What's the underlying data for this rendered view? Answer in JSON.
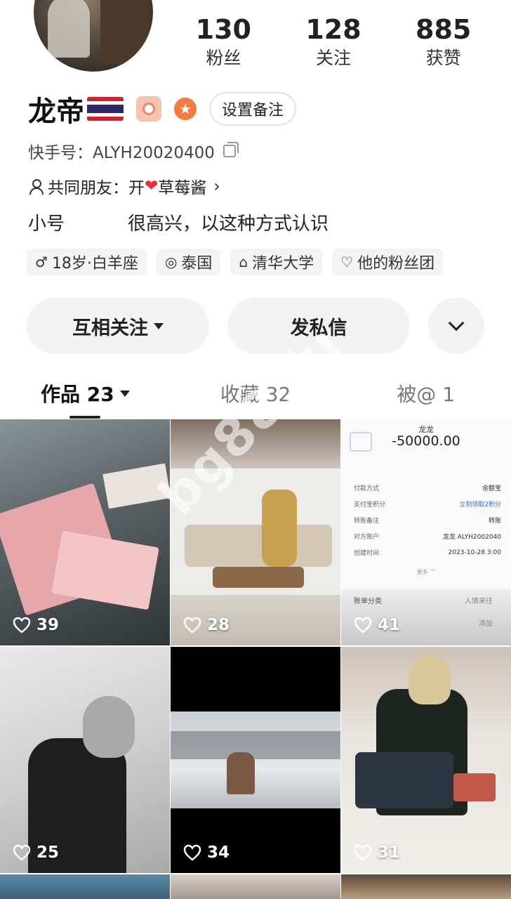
{
  "profile": {
    "name": "龙帝",
    "kuaishou_id": "快手号：ALYH20020400",
    "remark_button": "设置备注",
    "badge_star": "★",
    "mutual_friends_label": "共同朋友：",
    "mutual_friends_pre": "开",
    "mutual_friends_heart": "❤",
    "mutual_friends_post": "草莓酱",
    "mutual_chevron": "›",
    "bio_left": "小号",
    "bio_right": "很高兴，以这种方式认识"
  },
  "stats": [
    {
      "num": "130",
      "label": "粉丝"
    },
    {
      "num": "128",
      "label": "关注"
    },
    {
      "num": "885",
      "label": "获赞"
    }
  ],
  "tags": [
    {
      "icon": "♂",
      "label": "18岁·白羊座"
    },
    {
      "icon": "◎",
      "label": "泰国"
    },
    {
      "icon": "⌂",
      "label": "清华大学"
    },
    {
      "icon": "♡",
      "label": "他的粉丝团"
    }
  ],
  "actions": {
    "follow": "互相关注",
    "message": "发私信"
  },
  "tabs": [
    {
      "label": "作品 23",
      "active": true
    },
    {
      "label": "收藏 32",
      "active": false
    },
    {
      "label": "被@ 1",
      "active": false
    }
  ],
  "grid": [
    {
      "likes": "39"
    },
    {
      "likes": "28"
    },
    {
      "likes": "41"
    },
    {
      "likes": "25"
    },
    {
      "likes": "34"
    },
    {
      "likes": "31"
    }
  ],
  "receipt": {
    "payee": "龙龙",
    "amount": "-50000.00",
    "rows": [
      {
        "k": "付款方式",
        "v": "余额宝"
      },
      {
        "k": "支付宝积分",
        "v": "立刻领取2积分"
      },
      {
        "k": "转账备注",
        "v": "转账"
      },
      {
        "k": "对方账户",
        "v": "龙龙 ALYH2002040"
      },
      {
        "k": "创建时间",
        "v": "2023-10-28 3:00"
      }
    ],
    "more": "更多 ﹀",
    "bill_category": "账单分类",
    "bill_category_value": "人情来往",
    "add_label": "添加"
  },
  "watermark": "bg88.fu",
  "colors": {
    "accent_orange": "#f47a3f",
    "badge_peach": "#f6c5ae",
    "button_bg": "#f3f3f3",
    "heart_red": "#ee2b3a",
    "flag_red": "#d32130",
    "flag_blue": "#2d2a6b"
  }
}
